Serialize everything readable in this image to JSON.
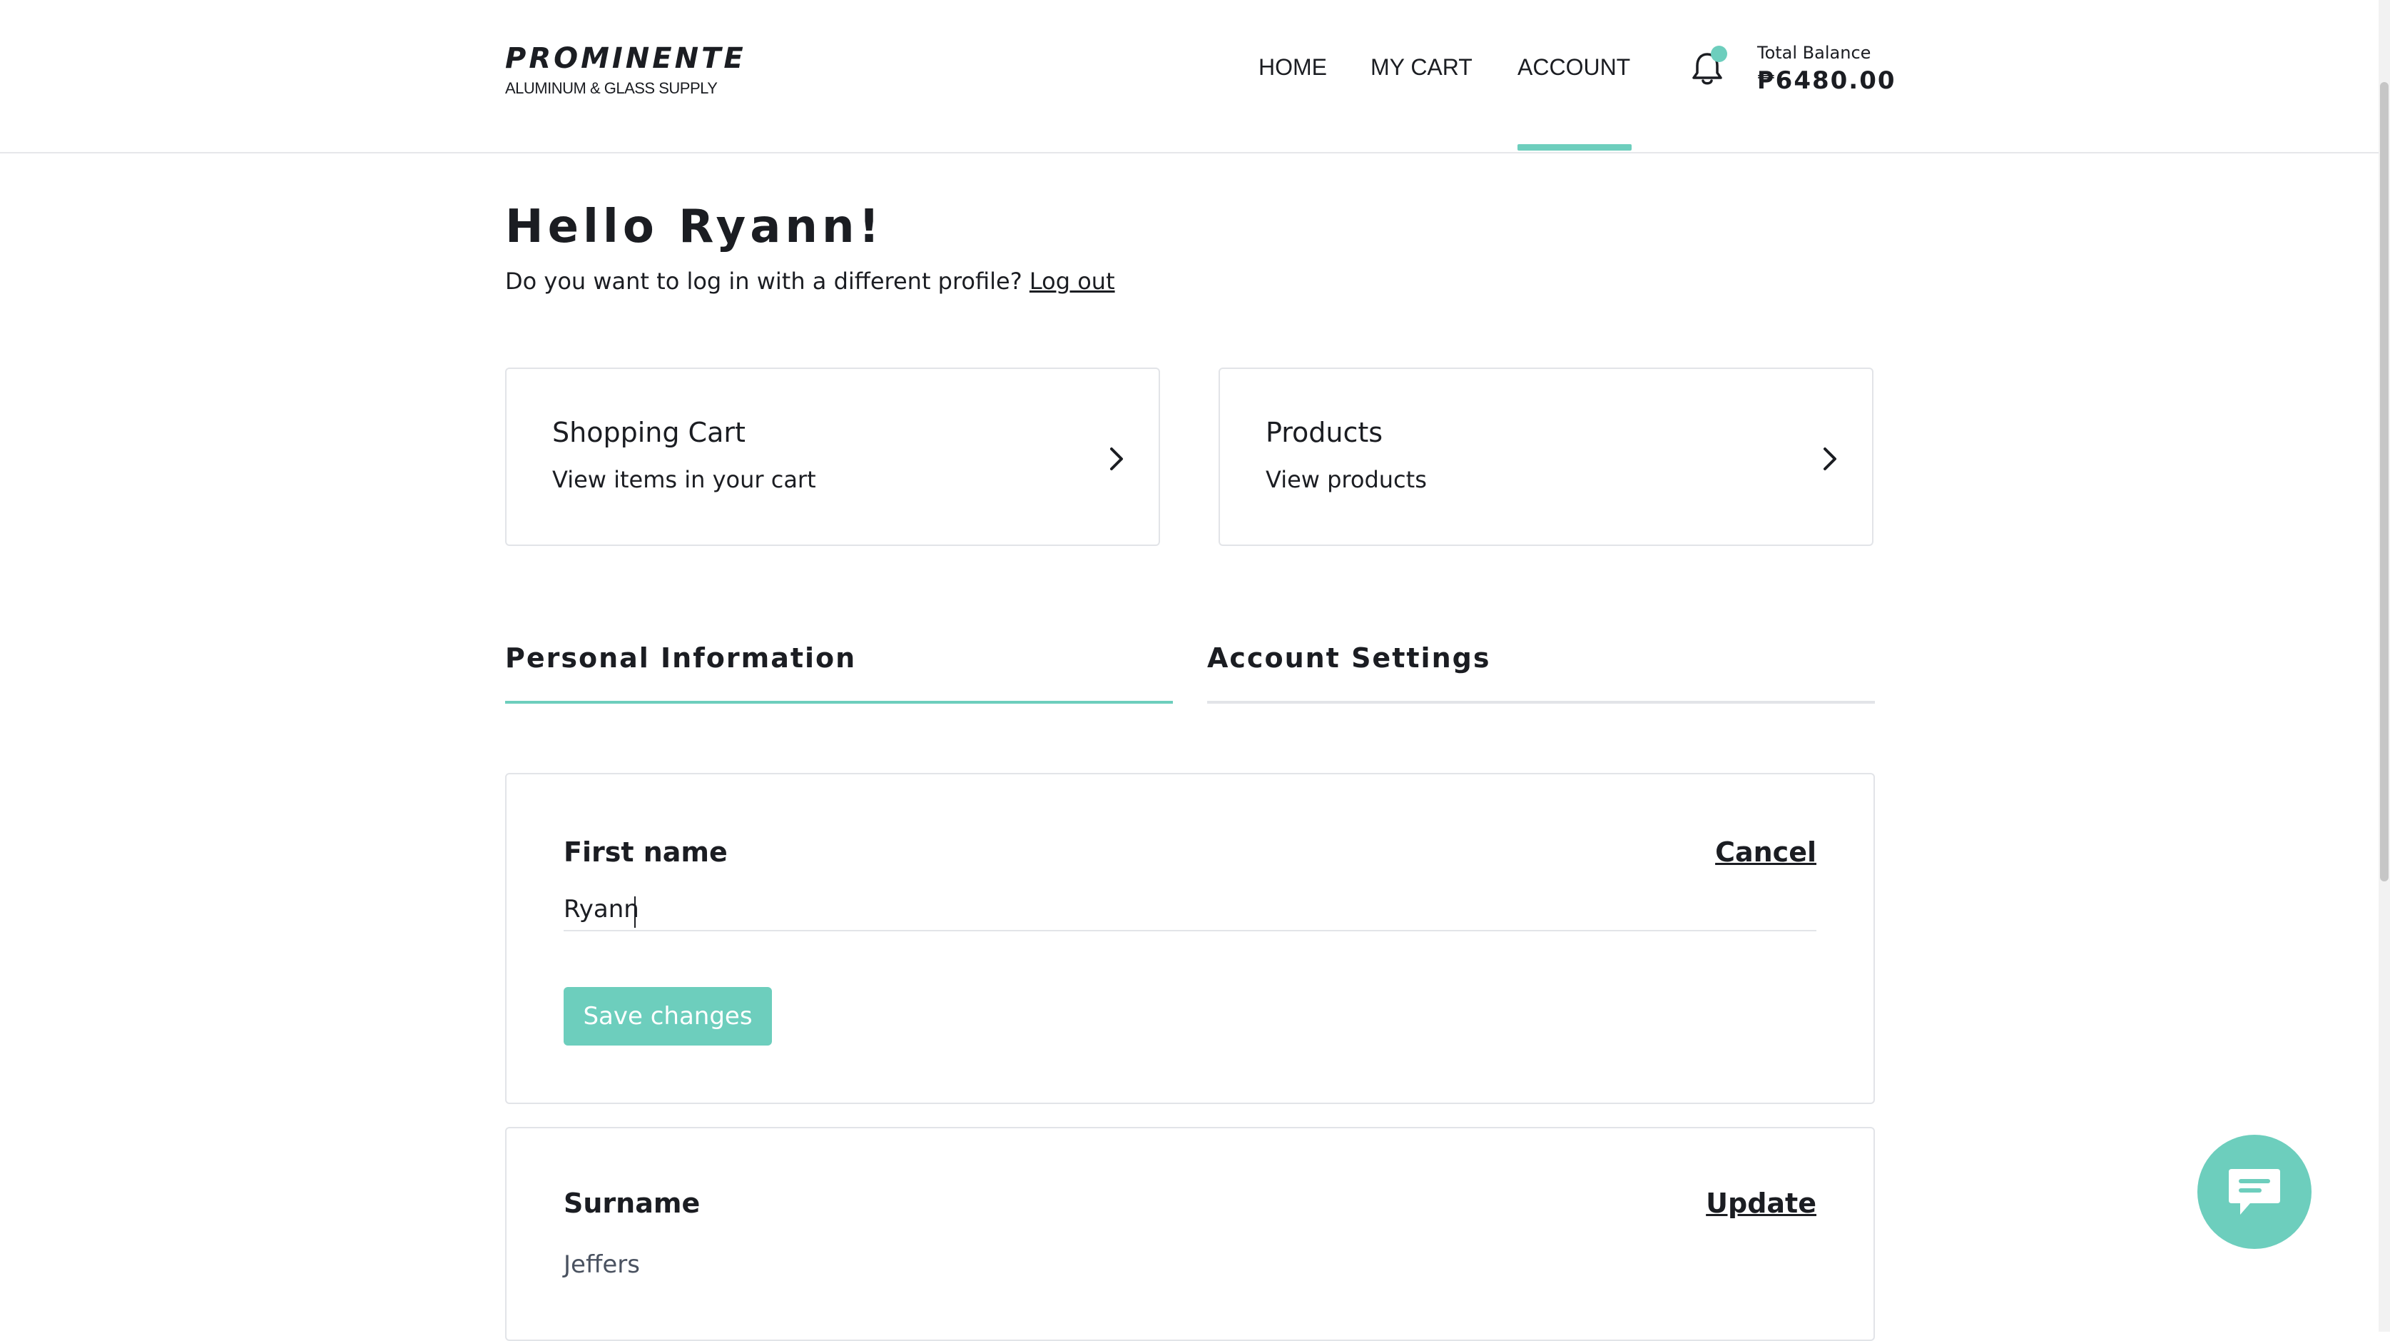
{
  "brand": {
    "name": "PROMINENTE",
    "tagline": "ALUMINUM & GLASS SUPPLY"
  },
  "nav": {
    "home": "HOME",
    "cart": "MY CART",
    "account": "ACCOUNT",
    "active": "ACCOUNT"
  },
  "balance": {
    "label": "Total Balance",
    "value": "₱6480.00"
  },
  "greeting": {
    "title": "Hello Ryann!",
    "question": "Do you want to log in with a different profile?",
    "logout": "Log out"
  },
  "cards": {
    "cart": {
      "title": "Shopping Cart",
      "subtitle": "View items in your cart"
    },
    "products": {
      "title": "Products",
      "subtitle": "View products"
    }
  },
  "tabs": {
    "personal": "Personal Information",
    "settings": "Account Settings",
    "active": "Personal Information"
  },
  "first_name": {
    "label": "First name",
    "action": "Cancel",
    "value": "Ryann",
    "save": "Save changes"
  },
  "surname": {
    "label": "Surname",
    "action": "Update",
    "value": "Jeffers"
  },
  "colors": {
    "accent": "#6dcebd",
    "text": "#1b1d22",
    "border": "#e2e4e8"
  },
  "icons": {
    "notifications": "bell-icon",
    "card_arrow": "chevron-right-icon",
    "chat": "chat-bubble-icon"
  }
}
